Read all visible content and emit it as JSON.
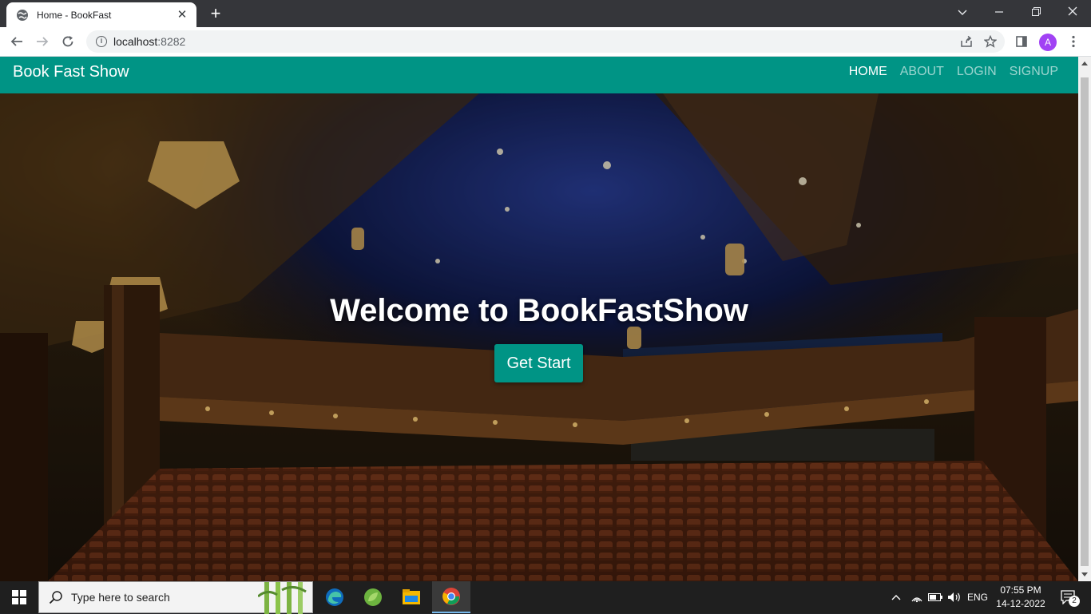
{
  "browser": {
    "tab_title": "Home - BookFast",
    "url_host": "localhost",
    "url_port": ":8282",
    "profile_initial": "A",
    "new_tab_symbol": "+",
    "close_tab_symbol": "✕"
  },
  "navbar": {
    "brand": "Book Fast Show",
    "links": [
      "HOME",
      "ABOUT",
      "LOGIN",
      "SIGNUP"
    ],
    "active": "HOME",
    "color": "#009485"
  },
  "hero": {
    "title": "Welcome to BookFastShow",
    "cta_label": "Get Start",
    "background": "theater-auditorium-image"
  },
  "taskbar": {
    "search_placeholder": "Type here to search",
    "language": "ENG",
    "time": "07:55 PM",
    "date": "14-12-2022",
    "notification_count": "2",
    "apps": [
      "edge-icon",
      "spring-tool-icon",
      "file-explorer-icon",
      "chrome-icon"
    ]
  }
}
